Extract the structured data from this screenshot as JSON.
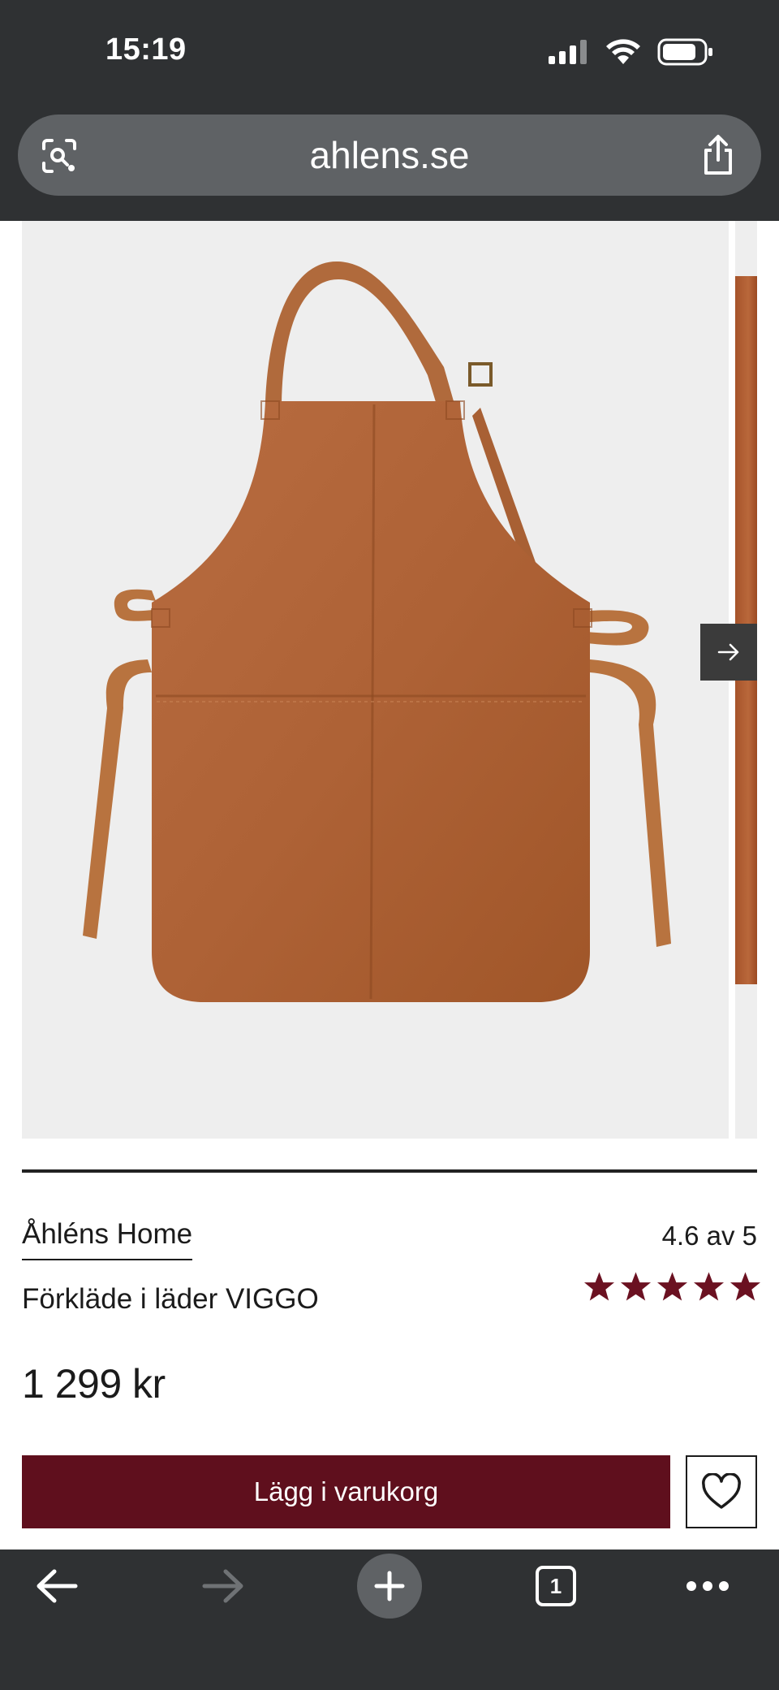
{
  "status_bar": {
    "time": "15:19",
    "icons": [
      "signal-icon",
      "wifi-icon",
      "battery-icon"
    ]
  },
  "browser": {
    "url": "ahlens.se",
    "left_icon": "camera-search-icon",
    "right_icon": "share-icon"
  },
  "gallery": {
    "main_image": "leather-apron-image",
    "next_icon": "arrow-right-icon"
  },
  "product": {
    "brand": "Åhléns Home",
    "rating_text": "4.6 av 5",
    "rating_value": 4.6,
    "rating_max": 5,
    "name": "Förkläde i läder VIGGO",
    "price": "1 299 kr",
    "add_to_cart_label": "Lägg i varukorg",
    "wishlist_icon": "heart-icon"
  },
  "toolbar": {
    "tab_count": "1",
    "icons": [
      "back-arrow-icon",
      "forward-arrow-icon",
      "plus-icon",
      "tabs-icon",
      "more-icon"
    ]
  },
  "colors": {
    "chrome": "#2f3133",
    "url_bar": "#5f6265",
    "accent": "#5f0f1d",
    "star": "#6b1121",
    "leather": "#b0643a"
  }
}
